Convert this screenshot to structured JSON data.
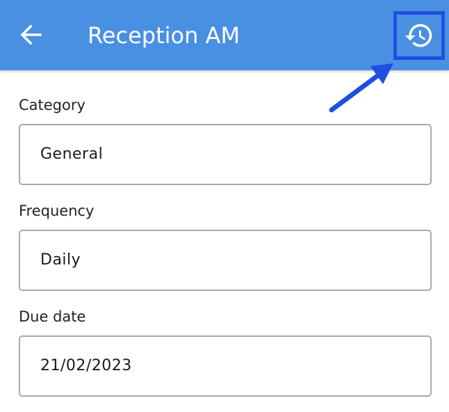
{
  "header": {
    "title": "Reception AM",
    "background_color": "#4a90e2",
    "back_icon": "arrow-left-icon",
    "history_icon": "history-icon"
  },
  "annotation": {
    "highlight_color": "#1f4fe0"
  },
  "form": {
    "fields": [
      {
        "label": "Category",
        "value": "General"
      },
      {
        "label": "Frequency",
        "value": "Daily"
      },
      {
        "label": "Due date",
        "value": "21/02/2023"
      }
    ]
  }
}
